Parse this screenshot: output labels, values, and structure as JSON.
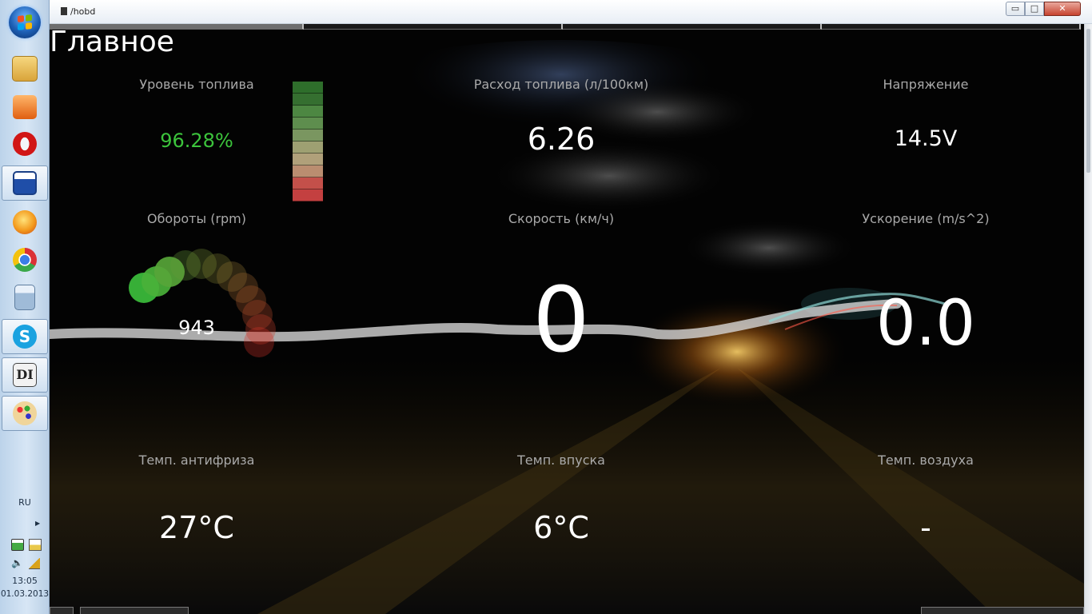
{
  "window": {
    "title": "/hobd",
    "min_symbol": "▭",
    "max_symbol": "□",
    "close_symbol": "✕"
  },
  "page": {
    "title": "Главное"
  },
  "tiles": {
    "fuel_level": {
      "label": "Уровень топлива",
      "value": "96.28%",
      "value_color": "#3cc43c",
      "level": 0.9628
    },
    "fuel_usage": {
      "label": "Расход топлива (л/100км)",
      "value": "6.26"
    },
    "voltage": {
      "label": "Напряжение",
      "value": "14.5V"
    },
    "rpm": {
      "label": "Обороты (rpm)",
      "value": "943"
    },
    "speed": {
      "label": "Скорость (км/ч)",
      "value": "0"
    },
    "acceleration": {
      "label": "Ускорение (m/s^2)",
      "value": "0.0"
    },
    "coolant_temp": {
      "label": "Темп. антифриза",
      "value": "27°C"
    },
    "intake_temp": {
      "label": "Темп. впуска",
      "value": "6°C"
    },
    "air_temp": {
      "label": "Темп. воздуха",
      "value": "-"
    }
  },
  "taskbar": {
    "apps": [
      {
        "name": "explorer-icon",
        "color": "#e6b84a"
      },
      {
        "name": "media-player-icon",
        "color": "#f07a1d"
      },
      {
        "name": "opera-icon",
        "color": "#d11616"
      },
      {
        "name": "save-app-icon",
        "color": "#1f4ea8"
      },
      {
        "name": "firefox-icon",
        "color": "#f39a1d"
      },
      {
        "name": "chrome-icon",
        "color": "#3aa84a"
      },
      {
        "name": "calculator-icon",
        "color": "#7fa3c9"
      },
      {
        "name": "skype-icon",
        "color": "#1aa2e0"
      },
      {
        "name": "hobd-icon",
        "color": "#555555"
      },
      {
        "name": "paint-icon",
        "color": "#d9a24a"
      }
    ],
    "tray": {
      "language": "RU",
      "time": "13:05",
      "date": "01.03.2013"
    }
  },
  "colors": {
    "accent_green": "#3cc43c",
    "text_gray": "#a9a9a9"
  }
}
